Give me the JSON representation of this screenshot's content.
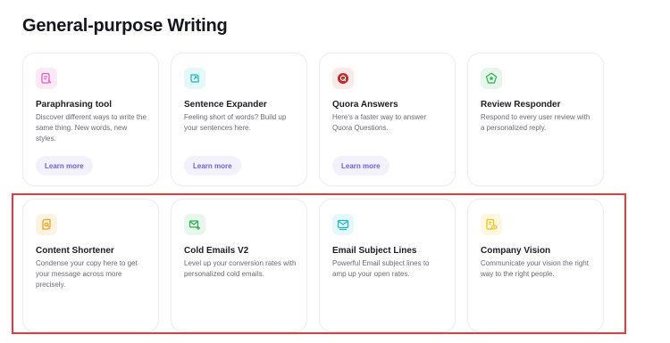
{
  "page_title": "General-purpose Writing",
  "learn_more_label": "Learn more",
  "highlight_color": "#e53a3f",
  "cards": [
    {
      "title": "Paraphrasing tool",
      "description": "Discover different ways to write the same thing. New words, new styles.",
      "icon": "paraphrase-icon",
      "icon_color": "#e35ac8",
      "icon_bg": "#fbeaf6",
      "has_button": true
    },
    {
      "title": "Sentence Expander",
      "description": "Feeling short of words? Build up your sentences here.",
      "icon": "expand-icon",
      "icon_color": "#1fb6c9",
      "icon_bg": "#e4f7f9",
      "has_button": true
    },
    {
      "title": "Quora Answers",
      "description": "Here's a faster way to answer Quora Questions.",
      "icon": "quora-icon",
      "icon_color": "#b92b27",
      "icon_bg": "#fbe9e8",
      "has_button": true
    },
    {
      "title": "Review Responder",
      "description": "Respond to every user review with a personalized reply.",
      "icon": "review-star-icon",
      "icon_color": "#2fae4f",
      "icon_bg": "#e7f6ea",
      "has_button": false
    },
    {
      "title": "Content Shortener",
      "description": "Condense your copy here to get your message across more precisely.",
      "icon": "shorten-icon",
      "icon_color": "#f0a21a",
      "icon_bg": "#fdf3e2",
      "has_button": false
    },
    {
      "title": "Cold Emails V2",
      "description": "Level up your conversion rates with personalized cold emails.",
      "icon": "mail-plus-icon",
      "icon_color": "#2fae4f",
      "icon_bg": "#e8f7ec",
      "has_button": false
    },
    {
      "title": "Email Subject Lines",
      "description": "Powerful Email subject lines to amp up your open rates.",
      "icon": "mail-lines-icon",
      "icon_color": "#1fb6c9",
      "icon_bg": "#e4f7f9",
      "has_button": false
    },
    {
      "title": "Company Vision",
      "description": "Communicate your vision the right way to the right people.",
      "icon": "vision-icon",
      "icon_color": "#e6c214",
      "icon_bg": "#fcf7de",
      "has_button": false
    }
  ]
}
